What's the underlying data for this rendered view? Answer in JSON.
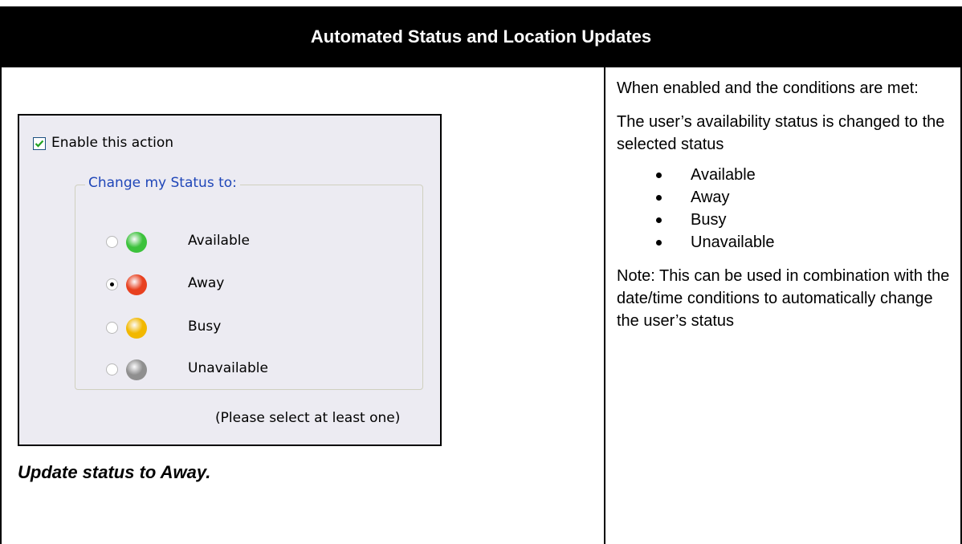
{
  "header": {
    "title": "Automated Status and Location Updates"
  },
  "panel": {
    "enable_checked": true,
    "enable_label": "Enable this action",
    "group_label": "Change my Status to:",
    "options": [
      {
        "label": "Available",
        "selected": false,
        "color": "#3cc23c"
      },
      {
        "label": "Away",
        "selected": true,
        "color": "#e8401f"
      },
      {
        "label": "Busy",
        "selected": false,
        "color": "#f2b800"
      },
      {
        "label": "Unavailable",
        "selected": false,
        "color": "#8f8f8f"
      }
    ],
    "hint": "(Please select at least one)"
  },
  "caption": "Update status to Away.",
  "description": {
    "intro": "When enabled and the conditions are met:",
    "body": "The user’s availability status is changed to the selected status",
    "bullets": [
      "Available",
      "Away",
      "Busy",
      "Unavailable"
    ],
    "note": "Note: This can be used in combination with the date/time conditions to automatically change the user’s status"
  }
}
